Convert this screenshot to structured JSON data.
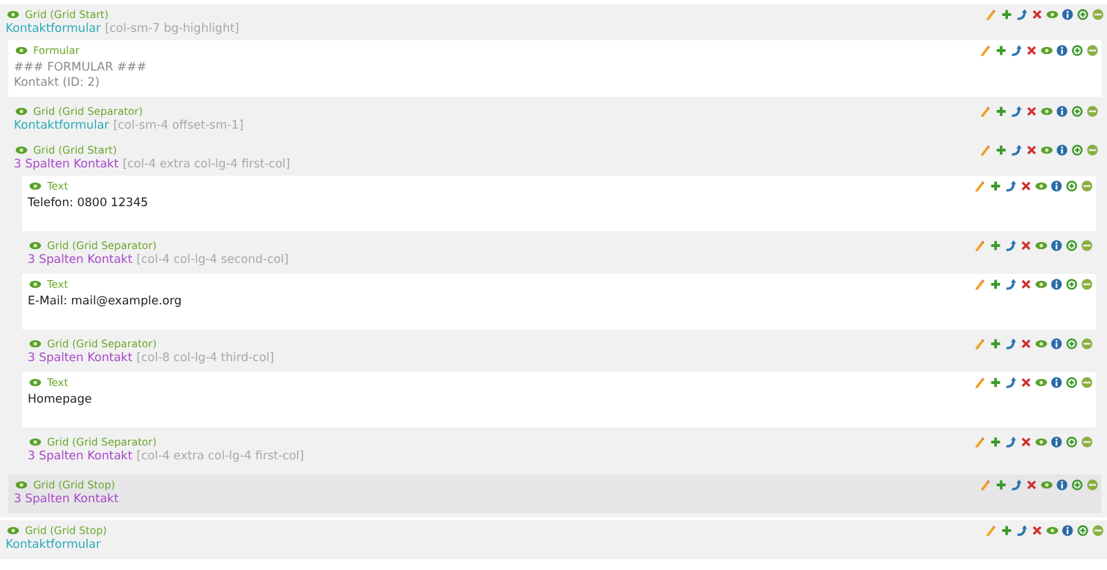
{
  "blocks": [
    {
      "kind": "start",
      "label": "Grid (Grid Start)",
      "title": "Kontaktformular",
      "classes": "[col-sm-7 bg-highlight]",
      "color": "#2aaab8",
      "children": [
        {
          "kind": "content",
          "label": "Formular",
          "muted": true,
          "body": [
            "### FORMULAR ###",
            "Kontakt (ID: 2)"
          ]
        },
        {
          "kind": "separator",
          "label": "Grid (Grid Separator)",
          "title": "Kontaktformular",
          "classes": "[col-sm-4 offset-sm-1]",
          "color": "#2aaab8"
        },
        {
          "kind": "start",
          "label": "Grid (Grid Start)",
          "title": "3 Spalten Kontakt",
          "classes": "[col-4 extra col-lg-4 first-col]",
          "color": "#a847c8",
          "children": [
            {
              "kind": "content",
              "label": "Text",
              "muted": false,
              "body": [
                "Telefon: 0800 12345"
              ]
            },
            {
              "kind": "separator",
              "label": "Grid (Grid Separator)",
              "title": "3 Spalten Kontakt",
              "classes": "[col-4 col-lg-4 second-col]",
              "color": "#a847c8"
            },
            {
              "kind": "content",
              "label": "Text",
              "muted": false,
              "body": [
                "E-Mail: mail@example.org"
              ]
            },
            {
              "kind": "separator",
              "label": "Grid (Grid Separator)",
              "title": "3 Spalten Kontakt",
              "classes": "[col-8 col-lg-4 third-col]",
              "color": "#a847c8"
            },
            {
              "kind": "content",
              "label": "Text",
              "muted": false,
              "body": [
                "Homepage"
              ]
            },
            {
              "kind": "separator",
              "label": "Grid (Grid Separator)",
              "title": "3 Spalten Kontakt",
              "classes": "[col-4 extra col-lg-4 first-col]",
              "color": "#a847c8"
            }
          ]
        },
        {
          "kind": "stop",
          "label": "Grid (Grid Stop)",
          "title": "3 Spalten Kontakt",
          "color": "#a847c8"
        }
      ]
    },
    {
      "kind": "stop",
      "label": "Grid (Grid Stop)",
      "title": "Kontaktformular",
      "color": "#2aaab8"
    }
  ]
}
